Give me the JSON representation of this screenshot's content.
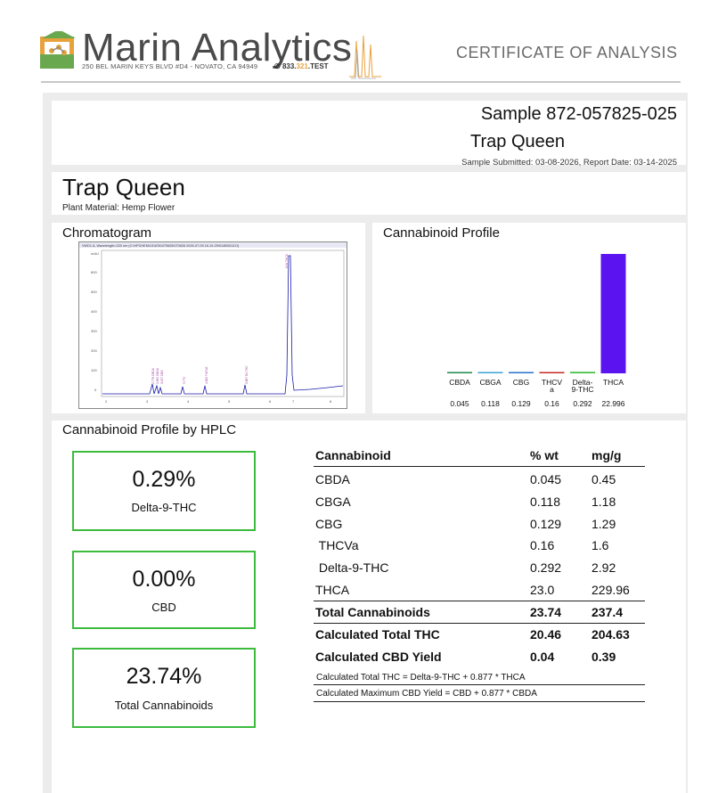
{
  "header": {
    "brand": "Marin Analytics",
    "address": "250 BEL MARIN KEYS BLVD #D4 - NOVATO, CA 94949",
    "phone_prefix": "833.",
    "phone_mid": "321",
    "phone_suffix": ".TEST",
    "doc_title": "CERTIFICATE OF ANALYSIS"
  },
  "sample": {
    "id": "Sample 872-057825-025",
    "name": "Trap Queen",
    "dates": "Sample Submitted: 03-08-2026, Report Date: 03-14-2025"
  },
  "product": {
    "name": "Trap Queen",
    "material": "Plant Material: Hemp Flower"
  },
  "sections": {
    "chromatogram": "Chromatogram",
    "profile": "Cannabinoid Profile",
    "hplc": "Cannabinoid Profile by HPLC"
  },
  "chromatogram": {
    "header_text": "VWD1 A, Wavelength=220 nm (C:\\HPCHEM\\1\\DATA\\070626\\070626 2026-07-09 16-19-29\\014B0013.D)",
    "y_ticks": [
      "mAU",
      "600",
      "500",
      "400",
      "300",
      "200",
      "100",
      "0"
    ],
    "x_ticks": [
      "2",
      "3",
      "4",
      "5",
      "6",
      "7",
      "8"
    ],
    "peak_labels": [
      "2.778 CBDA",
      "2.969 CBGA",
      "3.037 CBG",
      "3.779",
      "4.362 THCVA",
      "5.887 D9-THC",
      "6.94 THCA"
    ]
  },
  "summary": [
    {
      "value": "0.29%",
      "label": "Delta-9-THC"
    },
    {
      "value": "0.00%",
      "label": "CBD"
    },
    {
      "value": "23.74%",
      "label": "Total Cannabinoids"
    }
  ],
  "table": {
    "headers": [
      "Cannabinoid",
      "% wt",
      "mg/g"
    ],
    "rows": [
      [
        "CBDA",
        "0.045",
        "0.45"
      ],
      [
        "CBGA",
        "0.118",
        "1.18"
      ],
      [
        "CBG",
        "0.129",
        "1.29"
      ],
      [
        " THCVa",
        "0.16",
        "1.6"
      ],
      [
        " Delta-9-THC",
        "0.292",
        "2.92"
      ],
      [
        "THCA",
        "23.0",
        "229.96"
      ]
    ],
    "totals": [
      [
        "Total Cannabinoids",
        "23.74",
        "237.4"
      ],
      [
        "Calculated Total THC",
        "20.46",
        "204.63"
      ],
      [
        "Calculated CBD Yield",
        "0.04",
        "0.39"
      ]
    ],
    "notes": [
      "Calculated Total THC = Delta-9-THC + 0.877 * THCA",
      "Calculated Maximum CBD Yield = CBD + 0.877 * CBDA"
    ]
  },
  "chart_data": {
    "type": "bar",
    "title": "Cannabinoid Profile",
    "categories": [
      "CBDA",
      "CBGA",
      "CBG",
      "THCV a",
      "Delta- 9-THC",
      "THCA"
    ],
    "category_lines": [
      [
        "CBDA"
      ],
      [
        "CBGA"
      ],
      [
        "CBG"
      ],
      [
        "THCV",
        "a"
      ],
      [
        "Delta-",
        "9-THC"
      ],
      [
        "THCA"
      ]
    ],
    "values": [
      0.045,
      0.118,
      0.129,
      0.16,
      0.292,
      22.996
    ],
    "value_labels": [
      "0.045",
      "0.118",
      "0.129",
      "0.16",
      "0.292",
      "22.996"
    ],
    "colors": [
      "#1f8a4c",
      "#3ba3d6",
      "#2a6fd1",
      "#c62828",
      "#3fbf3f",
      "#5b14f0"
    ],
    "ylim": [
      0,
      23
    ]
  },
  "colors": {
    "accent_green": "#3dbb3d",
    "panel_gray": "#ececec"
  }
}
